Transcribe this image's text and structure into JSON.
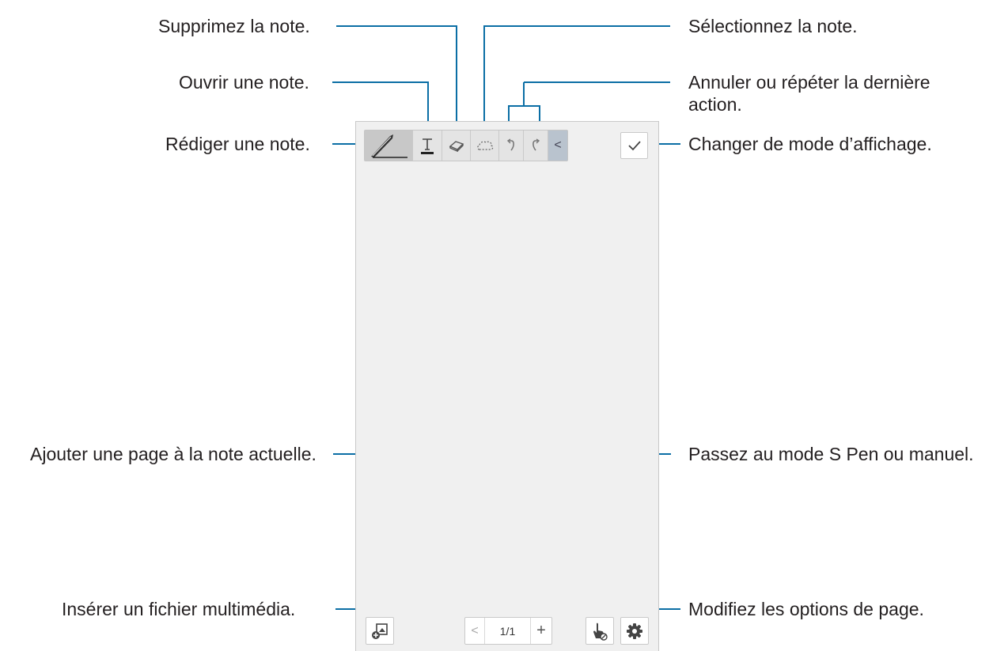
{
  "callouts": {
    "delete_note": "Supprimez la note.",
    "open_note": "Ouvrir une note.",
    "write_note": "Rédiger une note.",
    "select_note": "Sélectionnez la note.",
    "undo_redo": "Annuler ou répéter la dernière action.",
    "display_mode": "Changer de mode d’affichage.",
    "add_page": "Ajouter une page à la note actuelle.",
    "pen_mode": "Passez au mode S Pen ou manuel.",
    "insert_media": "Insérer un fichier multimédia.",
    "page_options": "Modifiez les options de page."
  },
  "pager": {
    "prev": "<",
    "page_indicator": "1/1",
    "add": "+"
  },
  "toolbar": {
    "collapse": "<"
  },
  "icons": [
    "pen-icon",
    "text-icon",
    "eraser-icon",
    "lasso-select-icon",
    "undo-icon",
    "redo-icon",
    "collapse-arrow-icon",
    "checkmark-icon",
    "insert-media-icon",
    "hand-pen-mode-icon",
    "gear-icon"
  ],
  "colors": {
    "callout_line": "#0b6ea5",
    "canvas": "#f0f0f0"
  }
}
